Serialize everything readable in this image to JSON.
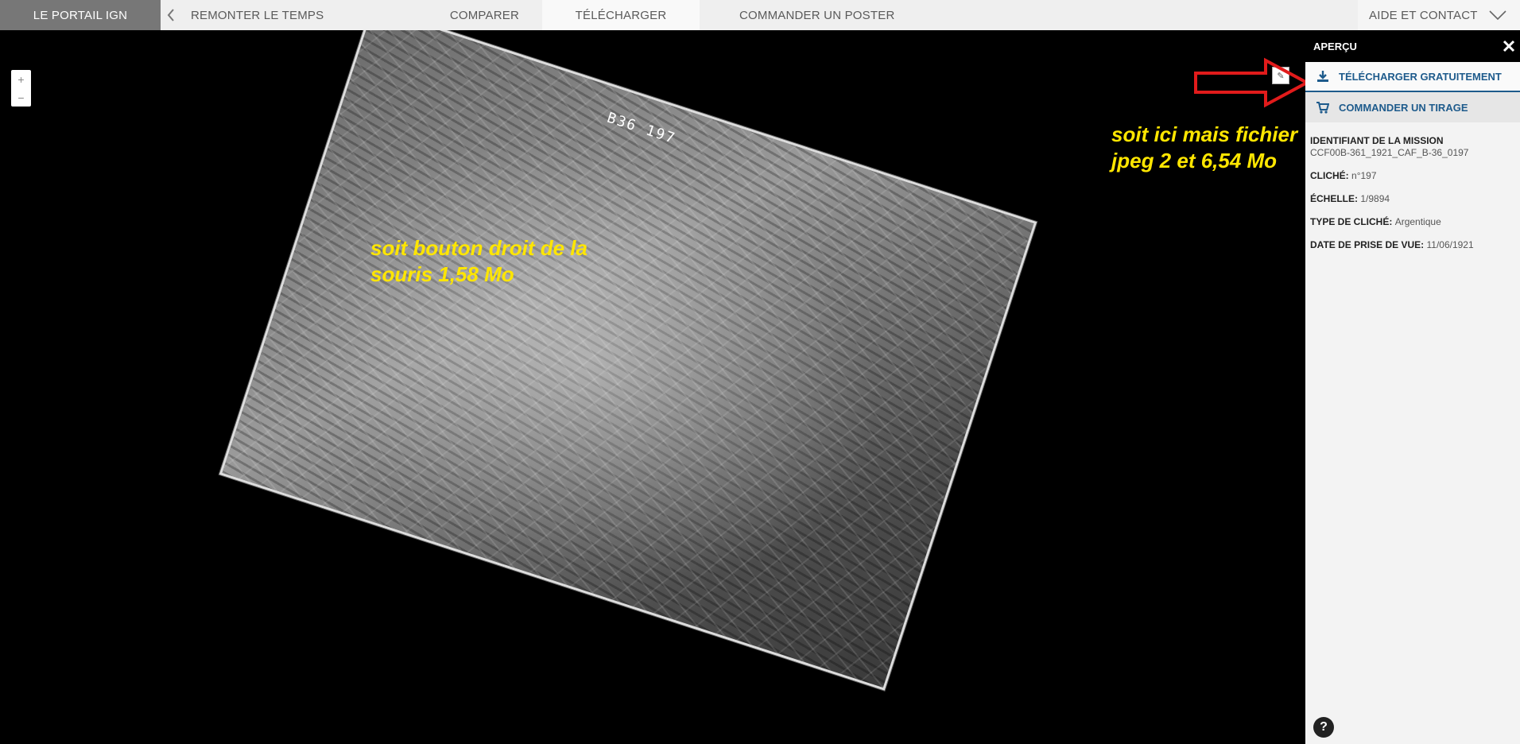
{
  "topbar": {
    "brand": "LE PORTAIL IGN",
    "nav": {
      "remonter": "REMONTER LE TEMPS",
      "comparer": "COMPARER",
      "telecharger": "TÉLÉCHARGER",
      "poster": "COMMANDER UN POSTER",
      "aide": "AIDE ET CONTACT"
    },
    "icons": {
      "back": "chevron-left-icon",
      "dropdown": "chevron-down-icon"
    }
  },
  "map": {
    "zoom": {
      "in": "+",
      "out": "−"
    },
    "photo_label": "B36 197",
    "annotations": {
      "left": "soit bouton droit de la souris 1,58 Mo",
      "right": "soit ici mais fichier jpeg 2 et 6,54 Mo"
    },
    "arrow_color": "#e11b1b"
  },
  "panel": {
    "title": "APERÇU",
    "buttons": {
      "download": "TÉLÉCHARGER GRATUITEMENT",
      "order": "COMMANDER UN TIRAGE"
    },
    "info": [
      {
        "key": "IDENTIFIANT DE LA MISSION",
        "value": "CCF00B-361_1921_CAF_B-36_0197"
      },
      {
        "key": "CLICHÉ",
        "value": "n°197"
      },
      {
        "key": "ÉCHELLE",
        "value": "1/9894"
      },
      {
        "key": "TYPE DE CLICHÉ",
        "value": "Argentique"
      },
      {
        "key": "DATE DE PRISE DE VUE",
        "value": "11/06/1921"
      }
    ],
    "help": "?",
    "accent_color": "#1e5b8c"
  }
}
